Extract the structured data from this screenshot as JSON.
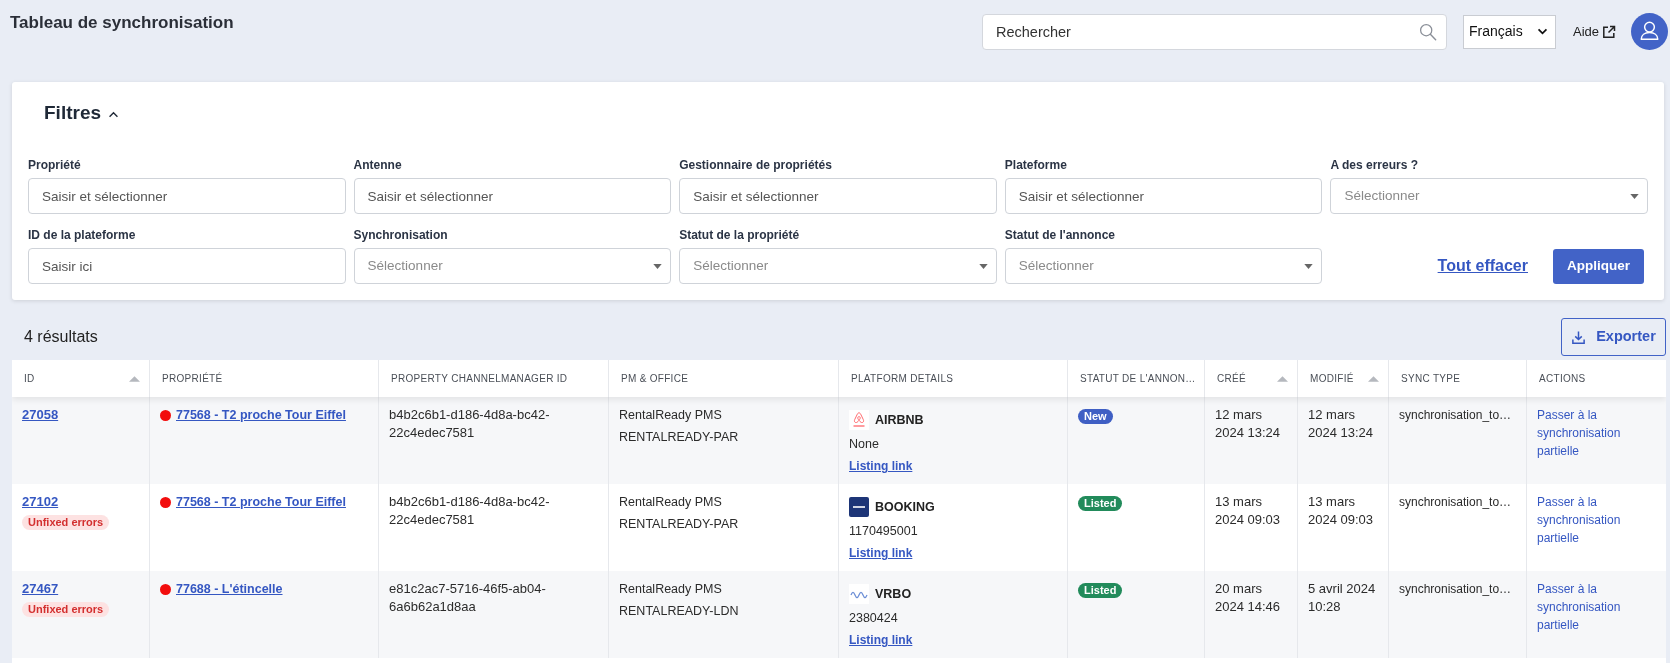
{
  "header": {
    "title": "Tableau de synchronisation",
    "search": {
      "placeholder": "Rechercher"
    },
    "language": {
      "value": "Français"
    },
    "help_link": "Aide"
  },
  "filters": {
    "title": "Filtres",
    "expanded": true,
    "fields": [
      {
        "label": "Propriété",
        "kind": "text",
        "placeholder": "Saisir et sélectionner"
      },
      {
        "label": "Antenne",
        "kind": "text",
        "placeholder": "Saisir et sélectionner"
      },
      {
        "label": "Gestionnaire de propriétés",
        "kind": "text",
        "placeholder": "Saisir et sélectionner"
      },
      {
        "label": "Plateforme",
        "kind": "text",
        "placeholder": "Saisir et sélectionner"
      },
      {
        "label": "A des erreurs ?",
        "kind": "select",
        "placeholder": "Sélectionner"
      },
      {
        "label": "ID de la plateforme",
        "kind": "text",
        "placeholder": "Saisir ici"
      },
      {
        "label": "Synchronisation",
        "kind": "select",
        "placeholder": "Sélectionner"
      },
      {
        "label": "Statut de la propriété",
        "kind": "select",
        "placeholder": "Sélectionner"
      },
      {
        "label": "Statut de l'annonce",
        "kind": "select",
        "placeholder": "Sélectionner"
      }
    ],
    "clear_button": "Tout effacer",
    "apply_button": "Appliquer"
  },
  "results": {
    "count": "4 résultats",
    "export_button": "Exporter"
  },
  "table": {
    "columns": [
      {
        "label": "ID",
        "sortable": true
      },
      {
        "label": "PROPRIÉTÉ",
        "sortable": false
      },
      {
        "label": "PROPERTY CHANNELMANAGER ID",
        "sortable": false
      },
      {
        "label": "PM & OFFICE",
        "sortable": false
      },
      {
        "label": "PLATFORM DETAILS",
        "sortable": false
      },
      {
        "label": "STATUT DE L'ANNON…",
        "sortable": false
      },
      {
        "label": "CRÉÉ",
        "sortable": true
      },
      {
        "label": "MODIFIÉ",
        "sortable": true
      },
      {
        "label": "SYNC TYPE",
        "sortable": false
      },
      {
        "label": "ACTIONS",
        "sortable": false
      }
    ],
    "rows": [
      {
        "id": "27058",
        "property": {
          "name": "77568 - T2 proche Tour Eiffel",
          "color": "#f20d0d"
        },
        "channel_manager_id": "b4b2c6b1-d186-4d8a-bc42-22c4edec7581",
        "pm": "RentalReady PMS",
        "office": "RENTALREADY-PAR",
        "platform": {
          "kind": "airbnb",
          "name": "AIRBNB",
          "listing_id": "None",
          "link": "Listing link"
        },
        "status": {
          "label": "New",
          "kind": "new"
        },
        "created": "12 mars 2024 13:24",
        "modified": "12 mars 2024 13:24",
        "sync_type": "synchronisation_to…",
        "action": "Passer à la synchronisation partielle"
      },
      {
        "id": "27102",
        "badge": "Unfixed errors",
        "property": {
          "name": "77568 - T2 proche Tour Eiffel",
          "color": "#f20d0d"
        },
        "channel_manager_id": "b4b2c6b1-d186-4d8a-bc42-22c4edec7581",
        "pm": "RentalReady PMS",
        "office": "RENTALREADY-PAR",
        "platform": {
          "kind": "booking",
          "name": "BOOKING",
          "listing_id": "1170495001",
          "link": "Listing link"
        },
        "status": {
          "label": "Listed",
          "kind": "listed"
        },
        "created": "13 mars 2024 09:03",
        "modified": "13 mars 2024 09:03",
        "sync_type": "synchronisation_to…",
        "action": "Passer à la synchronisation partielle"
      },
      {
        "id": "27467",
        "badge": "Unfixed errors",
        "property": {
          "name": "77688 - L'étincelle",
          "color": "#f20d0d"
        },
        "channel_manager_id": "e81c2ac7-5716-46f5-ab04-6a6b62a1d8aa",
        "pm": "RentalReady PMS",
        "office": "RENTALREADY-LDN",
        "platform": {
          "kind": "vrbo",
          "name": "VRBO",
          "listing_id": "2380424",
          "link": "Listing link"
        },
        "status": {
          "label": "Listed",
          "kind": "listed"
        },
        "created": "20 mars 2024 14:46",
        "modified": "5 avril 2024 10:28",
        "sync_type": "synchronisation_to…",
        "action": "Passer à la synchronisation partielle"
      }
    ]
  }
}
